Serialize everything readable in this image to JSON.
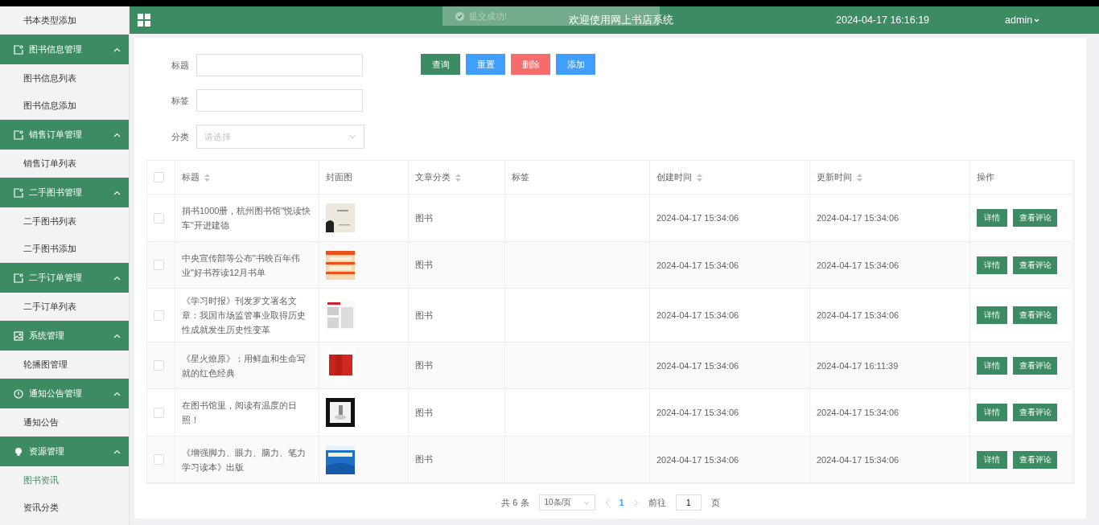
{
  "sidebar": {
    "items": [
      {
        "kind": "sub",
        "label": "书本类型添加",
        "selected": false
      },
      {
        "kind": "note",
        "label": "图书信息管理",
        "expanded": true
      },
      {
        "kind": "sub",
        "label": "图书信息列表",
        "selected": false
      },
      {
        "kind": "sub",
        "label": "图书信息添加",
        "selected": false
      },
      {
        "kind": "note",
        "label": "销售订单管理",
        "expanded": true
      },
      {
        "kind": "sub",
        "label": "销售订单列表",
        "selected": false
      },
      {
        "kind": "note",
        "label": "二手图书管理",
        "expanded": true
      },
      {
        "kind": "sub",
        "label": "二手图书列表",
        "selected": false
      },
      {
        "kind": "sub",
        "label": "二手图书添加",
        "selected": false
      },
      {
        "kind": "note",
        "label": "二手订单管理",
        "expanded": true
      },
      {
        "kind": "sub",
        "label": "二手订单列表",
        "selected": false
      },
      {
        "kind": "picture",
        "label": "系统管理",
        "expanded": true
      },
      {
        "kind": "sub",
        "label": "轮播图管理",
        "selected": false
      },
      {
        "kind": "info",
        "label": "通知公告管理",
        "expanded": true
      },
      {
        "kind": "sub",
        "label": "通知公告",
        "selected": false
      },
      {
        "kind": "bulb",
        "label": "资源管理",
        "expanded": true
      },
      {
        "kind": "sub",
        "label": "图书资讯",
        "selected": true
      },
      {
        "kind": "sub",
        "label": "资讯分类",
        "selected": false
      }
    ]
  },
  "header": {
    "title": "欢迎使用网上书店系统",
    "datetime": "2024-04-17 16:16:19",
    "user": "admin"
  },
  "toast": {
    "message": "提交成功!"
  },
  "filters": [
    {
      "kind": "input",
      "label": "标题"
    },
    {
      "kind": "input",
      "label": "标签"
    },
    {
      "kind": "select",
      "label": "分类",
      "placeholder": "请选择"
    }
  ],
  "actions": [
    {
      "label": "查询",
      "kind": "primary"
    },
    {
      "label": "重置",
      "kind": "info"
    },
    {
      "label": "删除",
      "kind": "danger"
    },
    {
      "label": "添加",
      "kind": "info"
    }
  ],
  "table": {
    "all_checked": false,
    "columns": [
      {
        "label": "标题",
        "sortable": true
      },
      {
        "label": "封面图",
        "sortable": false
      },
      {
        "label": "文章分类",
        "sortable": true
      },
      {
        "label": "标签",
        "sortable": false
      },
      {
        "label": "创建时间",
        "sortable": true
      },
      {
        "label": "更新时间",
        "sortable": true
      },
      {
        "label": "操作",
        "sortable": false
      }
    ],
    "rows": [
      {
        "checked": false,
        "title": "捐书1000册，杭州图书馆\"悦读快车\"开进建德",
        "cover": {
          "kind": "picture"
        },
        "category": "图书",
        "created": "2024-04-17 15:34:06",
        "updated": "2024-04-17 15:34:06",
        "buttons": [
          "详情",
          "查看评论"
        ]
      },
      {
        "checked": false,
        "title": "中央宣传部等公布\"书映百年伟业\"好书荐读12月书单",
        "cover": {
          "kind": "picture"
        },
        "category": "图书",
        "created": "2024-04-17 15:34:06",
        "updated": "2024-04-17 15:34:06",
        "buttons": [
          "详情",
          "查看评论"
        ]
      },
      {
        "checked": false,
        "title": "《学习时报》刊发罗文署名文章：我国市场监管事业取得历史性成就发生历史性变革",
        "cover": {
          "kind": "picture"
        },
        "category": "图书",
        "created": "2024-04-17 15:34:06",
        "updated": "2024-04-17 15:34:06",
        "buttons": [
          "详情",
          "查看评论"
        ]
      },
      {
        "checked": false,
        "title": "《星火燎原》：用鲜血和生命写就的红色经典",
        "cover": {
          "kind": "picture"
        },
        "category": "图书",
        "created": "2024-04-17 15:34:06",
        "updated": "2024-04-17 16:11:39",
        "buttons": [
          "详情",
          "查看评论"
        ]
      },
      {
        "checked": false,
        "title": "在图书馆里，阅读有温度的日照！",
        "cover": {
          "kind": "picture"
        },
        "category": "图书",
        "created": "2024-04-17 15:34:06",
        "updated": "2024-04-17 15:34:06",
        "buttons": [
          "详情",
          "查看评论"
        ]
      },
      {
        "checked": false,
        "title": "《增强脚力、眼力、脑力、笔力学习读本》出版",
        "cover": {
          "kind": "picture"
        },
        "category": "图书",
        "created": "2024-04-17 15:34:06",
        "updated": "2024-04-17 15:34:06",
        "buttons": [
          "详情",
          "查看评论"
        ]
      }
    ]
  },
  "pagination": {
    "total": "共 6 条",
    "page_size": "10条/页",
    "pages": [
      {
        "label": "1",
        "selected": true
      }
    ],
    "goto_label": "前往",
    "goto_value": "1",
    "goto_suffix": "页"
  }
}
